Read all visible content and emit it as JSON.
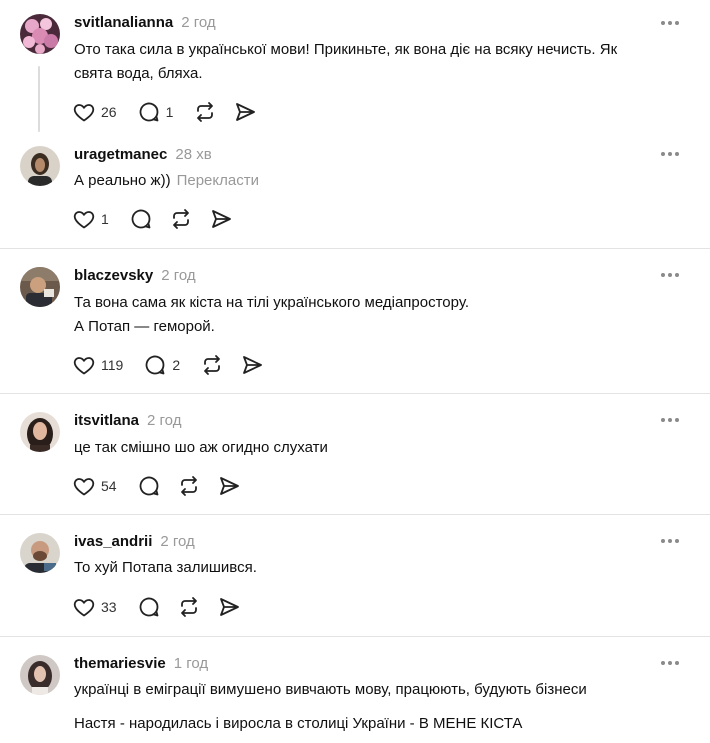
{
  "comments": [
    {
      "username": "svitlanalianna",
      "time": "2 год",
      "lines": [
        "Ото така сила в української мови! Прикиньте, як вона діє на всяку нечисть. Як",
        "свята вода, бляха."
      ],
      "likes": "26",
      "replies": "1"
    },
    {
      "username": "uragetmanec",
      "time": "28 хв",
      "lines": [
        "А реально ж))"
      ],
      "translate": "Перекласти",
      "likes": "1",
      "replies": ""
    },
    {
      "username": "blaczevsky",
      "time": "2 год",
      "lines": [
        "Та вона сама як кіста на тілі українського медіапростору.",
        "А Потап — геморой."
      ],
      "likes": "119",
      "replies": "2"
    },
    {
      "username": "itsvitlana",
      "time": "2 год",
      "lines": [
        "це так смішно шо аж огидно слухати"
      ],
      "likes": "54",
      "replies": ""
    },
    {
      "username": "ivas_andrii",
      "time": "2 год",
      "lines": [
        "То хуй Потапа залишився."
      ],
      "likes": "33",
      "replies": ""
    },
    {
      "username": "themariesvie",
      "time": "1 год",
      "lines": [
        "українці в еміграції вимушено вивчають мову, працюють, будують бізнеси",
        "Настя - народилась і виросла в столиці України - В МЕНЕ КІСТА"
      ]
    }
  ],
  "icons": {
    "like": "heart-icon",
    "reply": "comment-icon",
    "repost": "repost-icon",
    "share": "send-icon",
    "more": "more-icon"
  }
}
